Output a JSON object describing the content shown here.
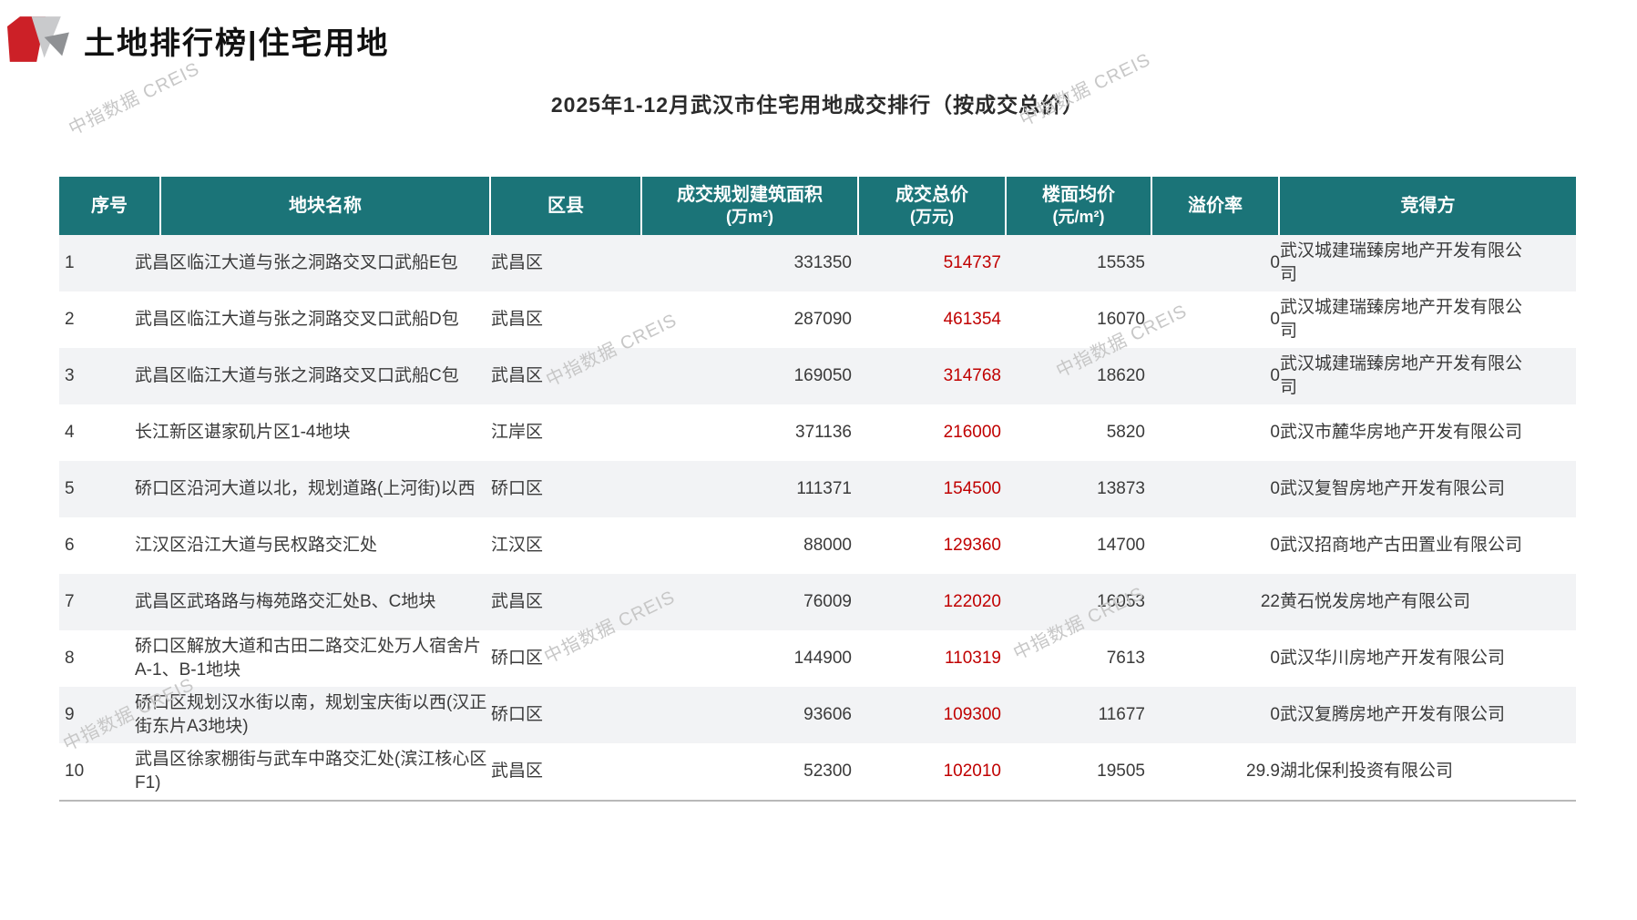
{
  "page": {
    "title": "土地排行榜|住宅用地",
    "subtitle": "2025年1-12月武汉市住宅用地成交排行（按成交总价）",
    "watermark": "中指数据 CREIS"
  },
  "colors": {
    "header_bg": "#1B7478",
    "accent_red": "#C00000",
    "logo_red": "#CC2027",
    "stripe": "#F2F3F5",
    "watermark": "#C7C7C7"
  },
  "table": {
    "columns": [
      {
        "key": "seq",
        "label": "序号",
        "unit": ""
      },
      {
        "key": "name",
        "label": "地块名称",
        "unit": ""
      },
      {
        "key": "district",
        "label": "区县",
        "unit": ""
      },
      {
        "key": "area",
        "label": "成交规划建筑面积",
        "unit": "(万m²)"
      },
      {
        "key": "total",
        "label": "成交总价",
        "unit": "(万元)"
      },
      {
        "key": "floor_avg",
        "label": "楼面均价",
        "unit": "(元/m²)"
      },
      {
        "key": "premium",
        "label": "溢价率",
        "unit": ""
      },
      {
        "key": "winner",
        "label": "竞得方",
        "unit": ""
      }
    ],
    "rows": [
      {
        "seq": "1",
        "name": "武昌区临江大道与张之洞路交叉口武船E包",
        "district": "武昌区",
        "area": "331350",
        "total": "514737",
        "floor_avg": "15535",
        "premium": "0",
        "winner": "武汉城建瑞臻房地产开发有限公司"
      },
      {
        "seq": "2",
        "name": "武昌区临江大道与张之洞路交叉口武船D包",
        "district": "武昌区",
        "area": "287090",
        "total": "461354",
        "floor_avg": "16070",
        "premium": "0",
        "winner": "武汉城建瑞臻房地产开发有限公司"
      },
      {
        "seq": "3",
        "name": "武昌区临江大道与张之洞路交叉口武船C包",
        "district": "武昌区",
        "area": "169050",
        "total": "314768",
        "floor_avg": "18620",
        "premium": "0",
        "winner": "武汉城建瑞臻房地产开发有限公司"
      },
      {
        "seq": "4",
        "name": "长江新区谌家矶片区1-4地块",
        "district": "江岸区",
        "area": "371136",
        "total": "216000",
        "floor_avg": "5820",
        "premium": "0",
        "winner": "武汉市麓华房地产开发有限公司"
      },
      {
        "seq": "5",
        "name": "硚口区沿河大道以北，规划道路(上河街)以西",
        "district": "硚口区",
        "area": "111371",
        "total": "154500",
        "floor_avg": "13873",
        "premium": "0",
        "winner": "武汉复智房地产开发有限公司"
      },
      {
        "seq": "6",
        "name": "江汉区沿江大道与民权路交汇处",
        "district": "江汉区",
        "area": "88000",
        "total": "129360",
        "floor_avg": "14700",
        "premium": "0",
        "winner": "武汉招商地产古田置业有限公司"
      },
      {
        "seq": "7",
        "name": "武昌区武珞路与梅苑路交汇处B、C地块",
        "district": "武昌区",
        "area": "76009",
        "total": "122020",
        "floor_avg": "16053",
        "premium": "22",
        "winner": "黄石悦发房地产有限公司"
      },
      {
        "seq": "8",
        "name": "硚口区解放大道和古田二路交汇处万人宿舍片A-1、B-1地块",
        "district": "硚口区",
        "area": "144900",
        "total": "110319",
        "floor_avg": "7613",
        "premium": "0",
        "winner": "武汉华川房地产开发有限公司"
      },
      {
        "seq": "9",
        "name": "硚口区规划汉水街以南，规划宝庆街以西(汉正街东片A3地块)",
        "district": "硚口区",
        "area": "93606",
        "total": "109300",
        "floor_avg": "11677",
        "premium": "0",
        "winner": "武汉复腾房地产开发有限公司"
      },
      {
        "seq": "10",
        "name": "武昌区徐家棚街与武车中路交汇处(滨江核心区F1)",
        "district": "武昌区",
        "area": "52300",
        "total": "102010",
        "floor_avg": "19505",
        "premium": "29.9",
        "winner": "湖北保利投资有限公司"
      }
    ]
  }
}
